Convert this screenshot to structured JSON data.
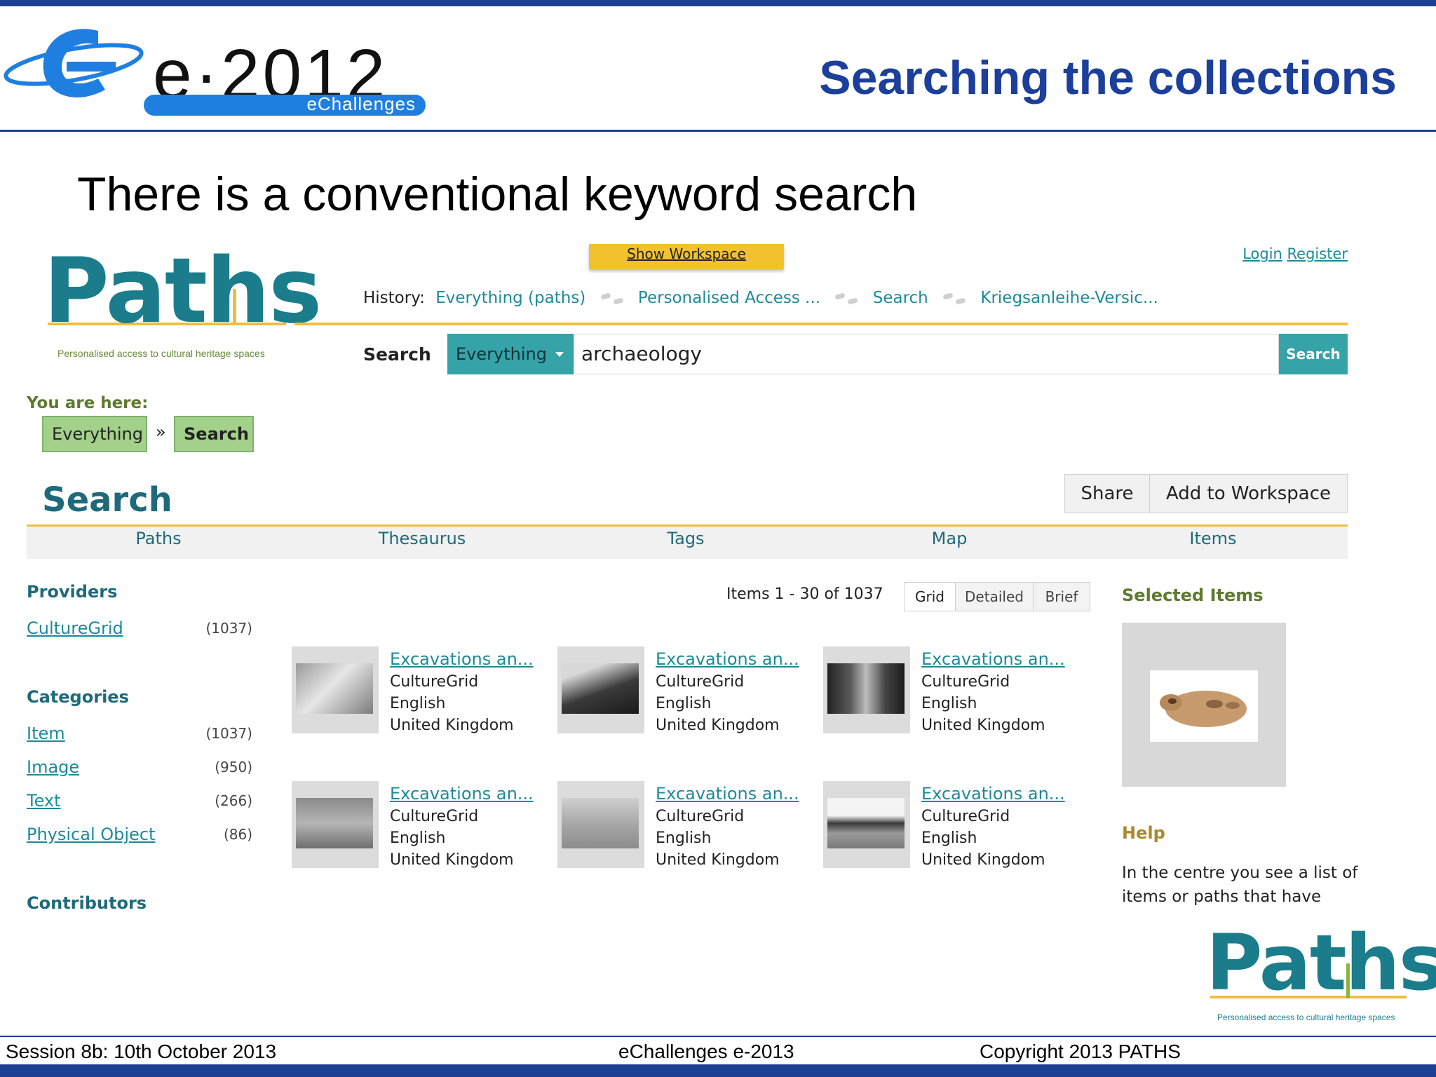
{
  "slide": {
    "title": "Searching the collections",
    "subtitle": "There is a conventional keyword search",
    "brand_year": "e·2012",
    "brand_name": "eChallenges"
  },
  "paths_logo": {
    "name": "Paths",
    "tagline": "Personalised access to cultural heritage spaces"
  },
  "workspace_button": "Show Workspace",
  "account": {
    "login": "Login",
    "register": "Register"
  },
  "history": {
    "label": "History:",
    "items": [
      "Everything (paths)",
      "Personalised Access ...",
      "Search",
      "Kriegsanleihe-Versic..."
    ]
  },
  "search": {
    "label": "Search",
    "scope": "Everything",
    "query": "archaeology",
    "button": "Search"
  },
  "breadcrumb": {
    "label": "You are here:",
    "items": [
      "Everything",
      "Search"
    ],
    "separator": "»"
  },
  "page": {
    "heading": "Search",
    "share": "Share",
    "add_to_workspace": "Add to Workspace"
  },
  "tabs": [
    "Paths",
    "Thesaurus",
    "Tags",
    "Map",
    "Items"
  ],
  "facets": {
    "providers_heading": "Providers",
    "providers": [
      {
        "label": "CultureGrid",
        "count": "(1037)"
      }
    ],
    "categories_heading": "Categories",
    "categories": [
      {
        "label": "Item",
        "count": "(1037)"
      },
      {
        "label": "Image",
        "count": "(950)"
      },
      {
        "label": "Text",
        "count": "(266)"
      },
      {
        "label": "Physical Object",
        "count": "(86)"
      }
    ],
    "contributors_heading": "Contributors"
  },
  "results": {
    "count": "Items 1 - 30 of 1037",
    "views": [
      "Grid",
      "Detailed",
      "Brief"
    ],
    "active_view": "Grid",
    "items": [
      {
        "title": "Excavations an...",
        "provider": "CultureGrid",
        "language": "English",
        "country": "United Kingdom"
      },
      {
        "title": "Excavations an...",
        "provider": "CultureGrid",
        "language": "English",
        "country": "United Kingdom"
      },
      {
        "title": "Excavations an...",
        "provider": "CultureGrid",
        "language": "English",
        "country": "United Kingdom"
      },
      {
        "title": "Excavations an...",
        "provider": "CultureGrid",
        "language": "English",
        "country": "United Kingdom"
      },
      {
        "title": "Excavations an...",
        "provider": "CultureGrid",
        "language": "English",
        "country": "United Kingdom"
      },
      {
        "title": "Excavations an...",
        "provider": "CultureGrid",
        "language": "English",
        "country": "United Kingdom"
      }
    ]
  },
  "sidebar": {
    "selected_heading": "Selected Items",
    "help_heading": "Help",
    "help_text": "In the centre you see a list of items or paths that have"
  },
  "footer": {
    "left": "Session 8b:  10th  October 2013",
    "center": "eChallenges e-2013",
    "right": "Copyright 2013 PATHS"
  },
  "colors": {
    "slide_blue": "#1b3f9a",
    "paths_teal": "#1b8b9a",
    "gold": "#f0be3c",
    "green_crumb": "#a3d18a"
  }
}
